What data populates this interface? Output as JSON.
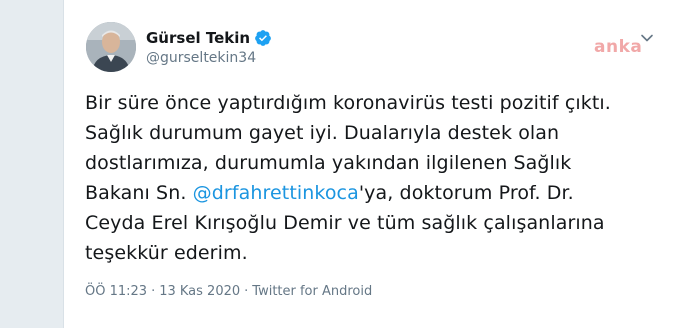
{
  "tweet": {
    "author": {
      "display_name": "Gürsel Tekin",
      "handle": "@gurseltekin34",
      "verified": true,
      "avatar_icon": "person-photo-icon"
    },
    "watermark": "anka",
    "lines": [
      "Bir süre önce yaptırdığım koronavirüs testi pozitif çıktı.",
      "Sağlık durumum gayet iyi. Dualarıyla destek olan",
      "dostlarımıza, durumumla yakından ilgilenen Sağlık"
    ],
    "line4": {
      "prefix": "Bakanı Sn. ",
      "mention": "@drfahrettinkoca",
      "suffix": "'ya, doktorum Prof. Dr."
    },
    "lines_after": [
      "Ceyda Erel Kırışoğlu Demir ve tüm sağlık çalışanlarına",
      "teşekkür ederim."
    ],
    "meta": {
      "time": "ÖÖ 11:23",
      "date": "13 Kas 2020",
      "source": "Twitter for Android",
      "separator": "·"
    }
  },
  "colors": {
    "background": "#e6ecf0",
    "card": "#ffffff",
    "text": "#14171a",
    "secondary": "#657786",
    "mention": "#1b95e0",
    "verified": "#1da1f2",
    "watermark": "#ef9a9a"
  }
}
